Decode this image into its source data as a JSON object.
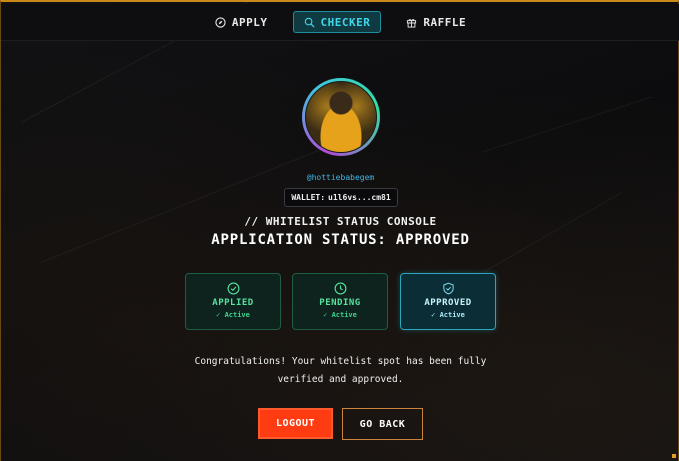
{
  "nav": {
    "items": [
      {
        "label": "APPLY",
        "icon": "compass-icon",
        "active": false
      },
      {
        "label": "CHECKER",
        "icon": "search-icon",
        "active": true
      },
      {
        "label": "RAFFLE",
        "icon": "gift-icon",
        "active": false
      }
    ]
  },
  "profile": {
    "handle": "@hottiebabegem",
    "wallet_label": "WALLET:",
    "wallet_value": "u1l6vs...cm81"
  },
  "console": {
    "title": "// WHITELIST STATUS CONSOLE",
    "status": "APPLICATION STATUS: APPROVED"
  },
  "steps": [
    {
      "label": "APPLIED",
      "state": "✓ Active",
      "icon": "check-circle-icon"
    },
    {
      "label": "PENDING",
      "state": "✓ Active",
      "icon": "clock-icon"
    },
    {
      "label": "APPROVED",
      "state": "✓ Active",
      "icon": "shield-check-icon"
    }
  ],
  "message": {
    "line1": "Congratulations! Your whitelist spot has been fully",
    "line2": "verified and approved."
  },
  "actions": {
    "logout": "LOGOUT",
    "back": "GO BACK"
  },
  "colors": {
    "accent_orange": "#ff3b12",
    "accent_cyan": "#3fd7e8",
    "accent_green": "#57e0a0",
    "border_gold": "#c98a1a"
  }
}
